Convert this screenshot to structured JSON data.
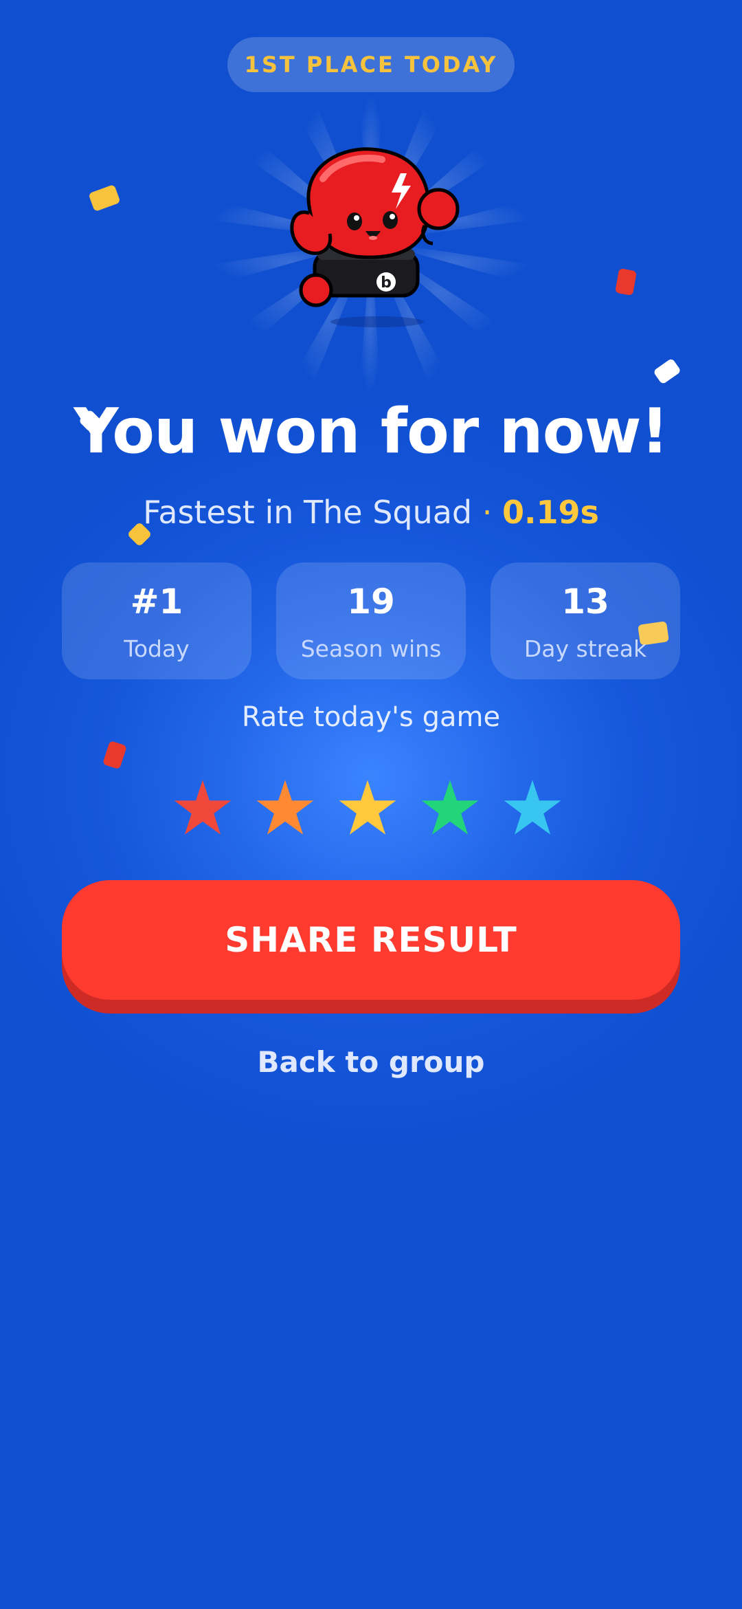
{
  "badge": {
    "text": "1ST PLACE TODAY"
  },
  "mascot": {
    "icon": "boxing-glove-mascot",
    "emblem": "b"
  },
  "title": "You won for now!",
  "subtitle": {
    "text": "Fastest in The Squad",
    "separator": "·",
    "time": "0.19s"
  },
  "stats": [
    {
      "value": "#1",
      "label": "Today"
    },
    {
      "value": "19",
      "label": "Season wins"
    },
    {
      "value": "13",
      "label": "Day streak"
    }
  ],
  "rating": {
    "label": "Rate today's game",
    "stars": [
      {
        "icon": "star-icon",
        "color": "#f0483a"
      },
      {
        "icon": "star-icon",
        "color": "#ff8a33"
      },
      {
        "icon": "star-icon",
        "color": "#ffc83d"
      },
      {
        "icon": "star-icon",
        "color": "#22d47a"
      },
      {
        "icon": "star-icon",
        "color": "#38c6f0"
      }
    ]
  },
  "share_button": {
    "label": "SHARE RESULT"
  },
  "back_link": {
    "label": "Back to group"
  },
  "colors": {
    "background": "#0f4fd0",
    "accent_yellow": "#ffc83d",
    "button_red": "#ff3b30"
  }
}
